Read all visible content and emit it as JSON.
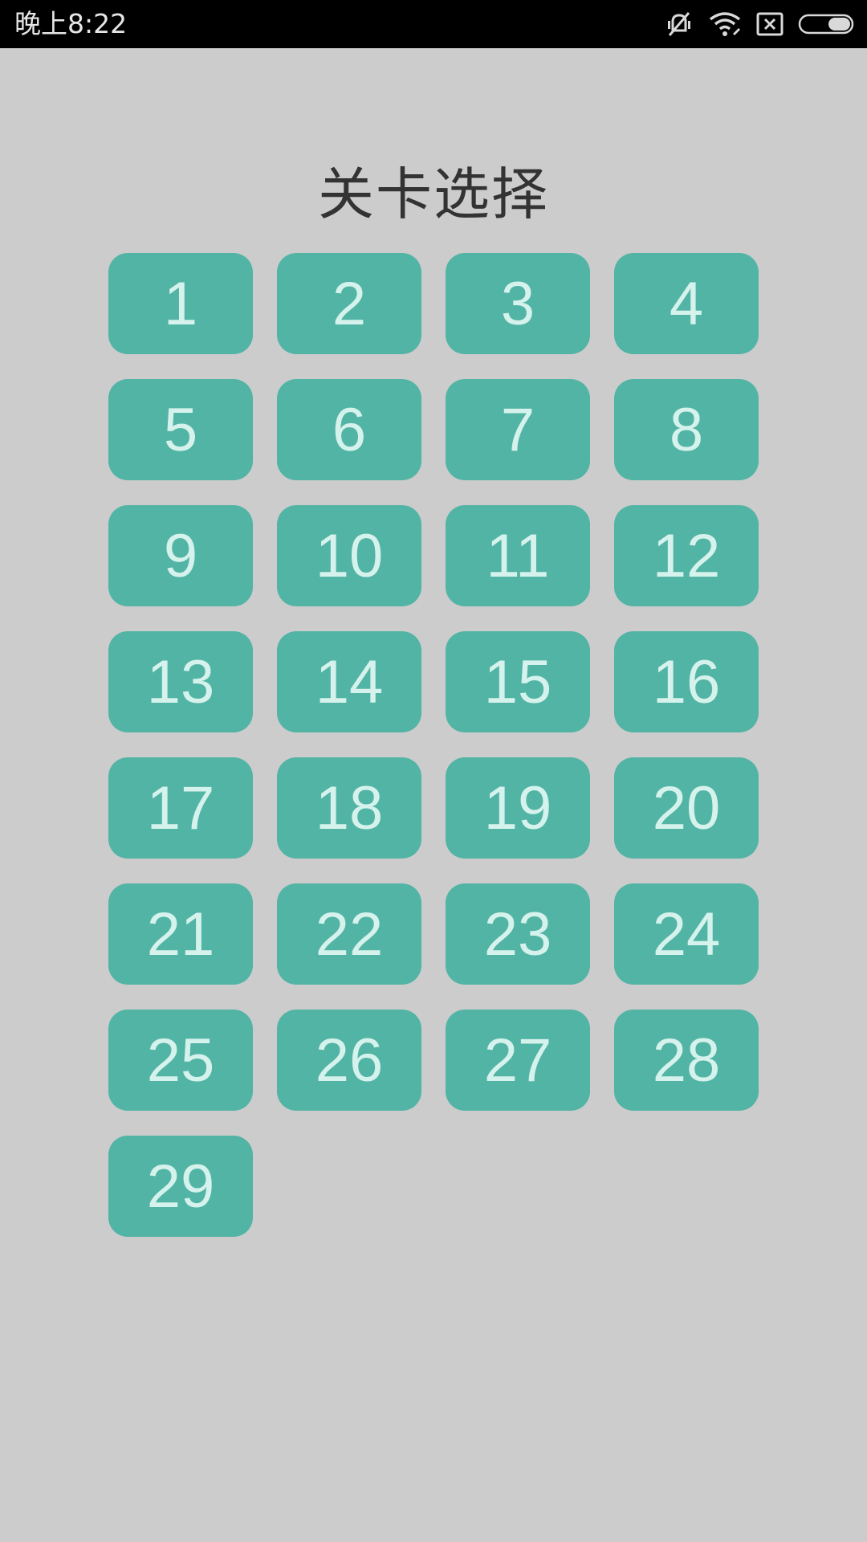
{
  "status_bar": {
    "time": "晚上8:22",
    "icons": [
      "vibrate-off-icon",
      "wifi-icon",
      "sim-blocked-icon",
      "battery-icon"
    ]
  },
  "screen": {
    "title": "关卡选择"
  },
  "levels": [
    "1",
    "2",
    "3",
    "4",
    "5",
    "6",
    "7",
    "8",
    "9",
    "10",
    "11",
    "12",
    "13",
    "14",
    "15",
    "16",
    "17",
    "18",
    "19",
    "20",
    "21",
    "22",
    "23",
    "24",
    "25",
    "26",
    "27",
    "28",
    "29"
  ],
  "colors": {
    "background": "#cccccc",
    "button": "#52b4a5",
    "button_text": "#d5f2ec",
    "title_text": "#333333"
  }
}
